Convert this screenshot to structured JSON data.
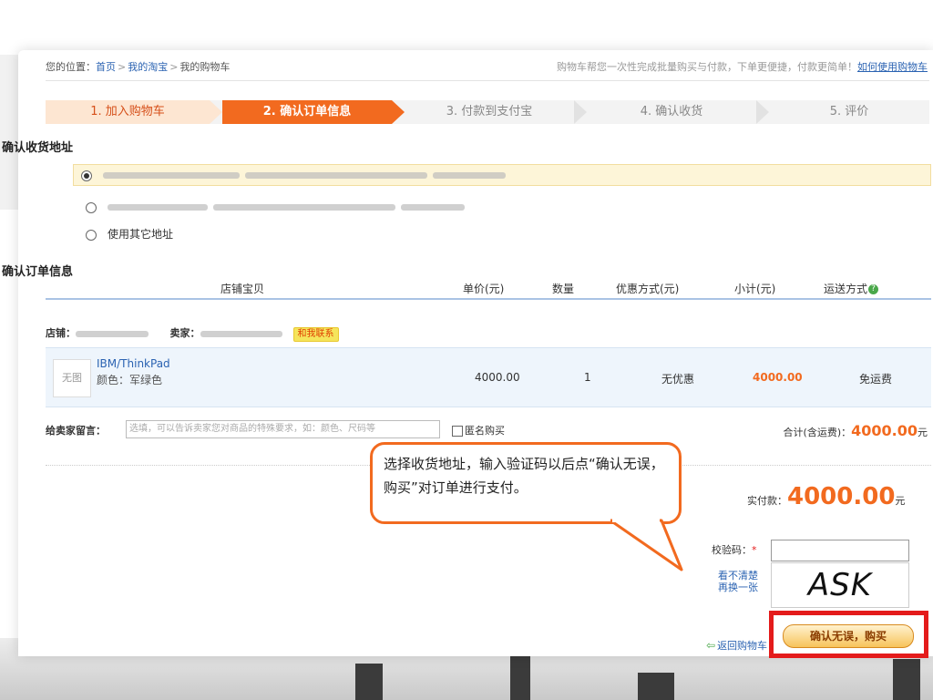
{
  "breadcrumb": {
    "prefix": "您的位置：",
    "home": "首页",
    "my_taobao": "我的淘宝",
    "current": "我的购物车",
    "sep": ">"
  },
  "promo": {
    "text": "购物车帮您一次性完成批量购买与付款，下单更便捷，付款更简单！",
    "link": "如何使用购物车"
  },
  "steps": [
    {
      "label": "1. 加入购物车"
    },
    {
      "label": "2. 确认订单信息"
    },
    {
      "label": "3. 付款到支付宝"
    },
    {
      "label": "4. 确认收货"
    },
    {
      "label": "5. 评价"
    }
  ],
  "address": {
    "title": "确认收货地址",
    "other_label": "使用其它地址"
  },
  "order": {
    "title": "确认订单信息",
    "headers": {
      "item": "店铺宝贝",
      "price": "单价(元)",
      "qty": "数量",
      "discount": "优惠方式(元)",
      "subtotal": "小计(元)",
      "shipping": "运送方式"
    },
    "shop_label": "店铺：",
    "seller_label": "卖家：",
    "contact": "和我联系",
    "item": {
      "no_image": "无图",
      "name": "IBM/ThinkPad",
      "color": "颜色：军绿色",
      "price": "4000.00",
      "qty": "1",
      "discount": "无优惠",
      "subtotal": "4000.00",
      "shipping": "免运费"
    },
    "message_label": "给卖家留言：",
    "message_placeholder": "选填，可以告诉卖家您对商品的特殊要求，如：颜色、尺码等",
    "anonymous": "匿名购买",
    "total_label": "合计(含运费)：",
    "total_value": "4000.00",
    "currency": "元"
  },
  "payment": {
    "label": "实付款：",
    "value": "4000.00",
    "currency": "元",
    "captcha_label": "校验码：",
    "required": "*",
    "captcha_text": "ASK",
    "refresh_line1": "看不清楚",
    "refresh_line2": "再换一张",
    "back_link": "返回购物车",
    "confirm_button": "确认无误，购买"
  },
  "callout": {
    "text": "选择收货地址，输入验证码以后点“确认无误，购买”对订单进行支付。"
  },
  "colors": {
    "accent": "#f26a1f",
    "link": "#2b63b2",
    "highlight_box": "#e41b1b"
  }
}
